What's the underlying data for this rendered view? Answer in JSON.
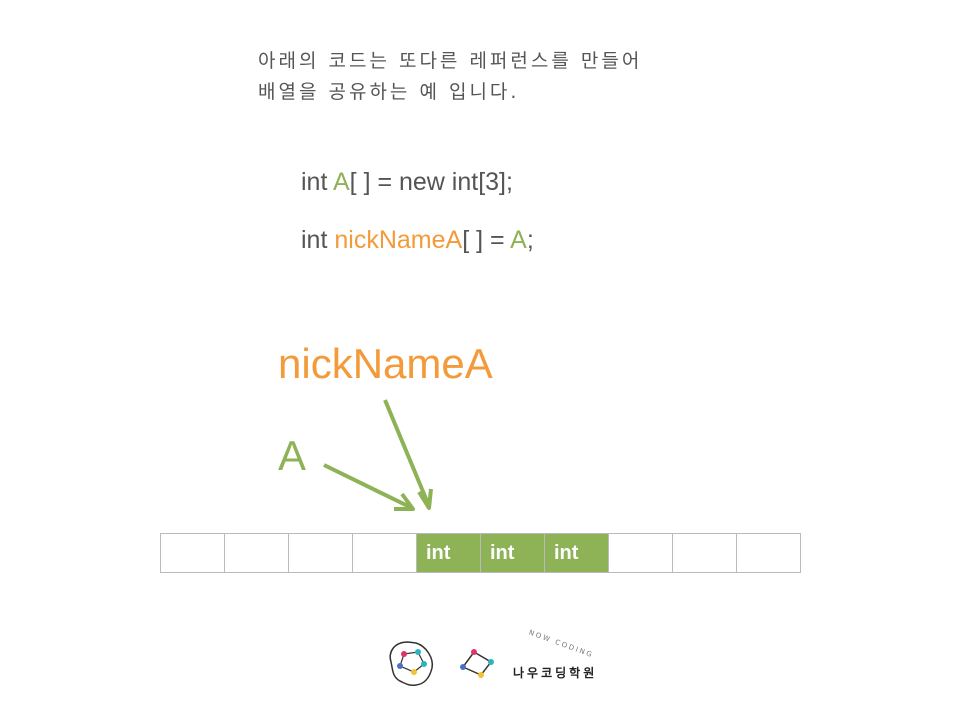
{
  "intro": {
    "line1": "아래의 코드는 또다른 레퍼런스를 만들어",
    "line2": "배열을 공유하는 예 입니다."
  },
  "code": {
    "line1": {
      "kw": "int ",
      "var": "A",
      "rest": "[ ] = new int[3];"
    },
    "line2": {
      "kw": "int ",
      "var": "nickNameA",
      "mid": "[ ] = ",
      "ref": "A",
      "end": ";"
    }
  },
  "labels": {
    "nickname": "nickNameA",
    "a": "A"
  },
  "memory": {
    "cells": [
      "",
      "",
      "",
      "",
      "int",
      "int",
      "int",
      "",
      "",
      ""
    ],
    "filled": [
      false,
      false,
      false,
      false,
      true,
      true,
      true,
      false,
      false,
      false
    ]
  },
  "brand": {
    "name": "나우코딩학원",
    "tagline": "NOW CODING"
  },
  "colors": {
    "green": "#8db356",
    "orange": "#f39a3a",
    "text": "#555555"
  }
}
